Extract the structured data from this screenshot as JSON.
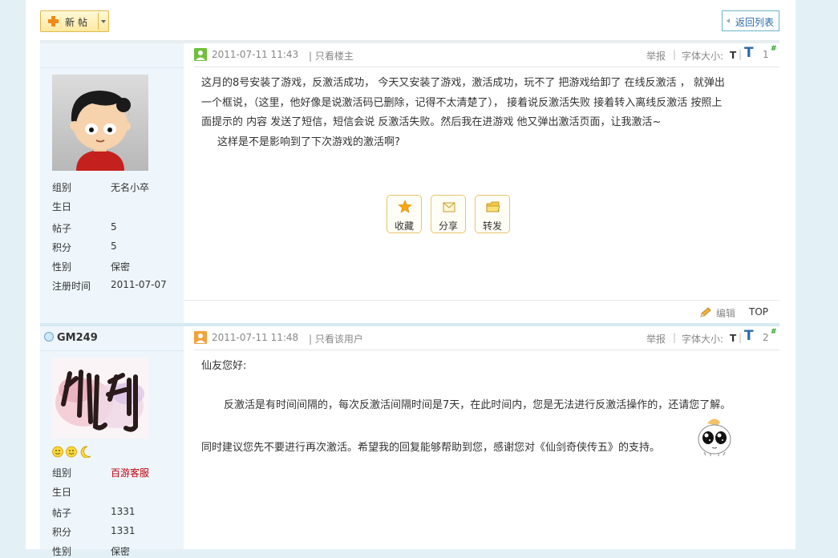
{
  "toolbar": {
    "new_post_label": "新帖",
    "back_list_label": "返回列表"
  },
  "posts": [
    {
      "author": "",
      "info": [
        {
          "k": "组别",
          "v": "无名小卒"
        },
        {
          "k": "生日",
          "v": ""
        },
        {
          "k": "帖子",
          "v": "5"
        },
        {
          "k": "积分",
          "v": "5"
        },
        {
          "k": "性别",
          "v": "保密"
        },
        {
          "k": "注册时间",
          "v": "2011-07-07"
        }
      ],
      "date": "2011-07-11 11:43",
      "filter_link": "| 只看楼主",
      "report": "举报",
      "font_size_label": "字体大小:",
      "font_small": "T",
      "font_big": "T",
      "floor": "1",
      "floor_mark": "#",
      "content": [
        "这月的8号安装了游戏，反激活成功，  今天又安装了游戏，激活成功，玩不了  把游戏给卸了  在线反激活 ， 就弹出",
        "一个框说，（这里，他好像是说激活码已删除，记得不太清楚了），  接着说反激活失败  接着转入离线反激活  按照上",
        "面提示的  内容  发送了短信，短信会说  反激活失败。然后我在进游戏  他又弹出激活页面，让我激活~",
        "     这样是不是影响到了下次游戏的激活啊?"
      ],
      "actions": [
        "收藏",
        "分享",
        "转发"
      ],
      "footer": {
        "edit": "编辑",
        "top": "TOP"
      }
    },
    {
      "author": "GM249",
      "info": [
        {
          "k": "组别",
          "v": "百游客服"
        },
        {
          "k": "生日",
          "v": ""
        },
        {
          "k": "帖子",
          "v": "1331"
        },
        {
          "k": "积分",
          "v": "1331"
        },
        {
          "k": "性别",
          "v": "保密"
        }
      ],
      "date": "2011-07-11 11:48",
      "filter_link": "| 只看该用户",
      "report": "举报",
      "font_size_label": "字体大小:",
      "font_small": "T",
      "font_big": "T",
      "floor": "2",
      "floor_mark": "#",
      "content": [
        "仙友您好:",
        "",
        "        反激活是有时间间隔的，每次反激活间隔时间是7天，在此时间内，您是无法进行反激活操作的，还请您了解。",
        "",
        "同时建议您先不要进行再次激活。希望我的回复能够帮助到您，感谢您对《仙剑奇侠传五》的支持。"
      ]
    }
  ],
  "colors": {
    "page_bg": "#e3f1f7",
    "sidebar_bg": "#eef6fb",
    "link_blue": "#2a6aa8",
    "staff_red": "#c0000c"
  }
}
